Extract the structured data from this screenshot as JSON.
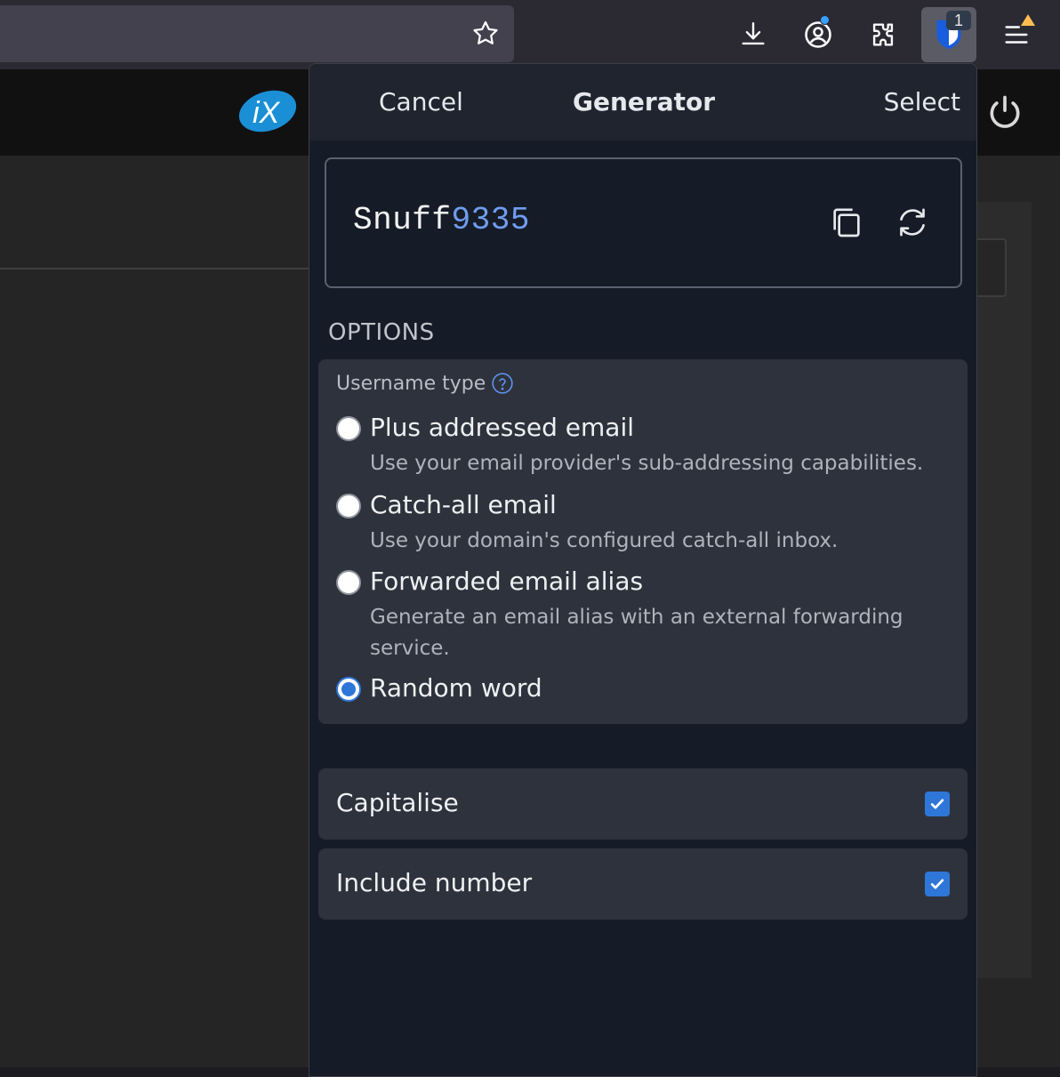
{
  "browser": {
    "extension_badge": "1",
    "icons": [
      "bookmark-star-icon",
      "downloads-icon",
      "account-icon",
      "extensions-icon",
      "bitwarden-icon",
      "menu-icon"
    ]
  },
  "generator": {
    "header": {
      "cancel": "Cancel",
      "title": "Generator",
      "select": "Select"
    },
    "generated": {
      "word": "Snuff",
      "number": "9335"
    },
    "options_heading": "OPTIONS",
    "username_type_label": "Username type",
    "types": [
      {
        "title": "Plus addressed email",
        "description": "Use your email provider's sub-addressing capabilities.",
        "checked": false
      },
      {
        "title": "Catch-all email",
        "description": "Use your domain's configured catch-all inbox.",
        "checked": false
      },
      {
        "title": "Forwarded email alias",
        "description": "Generate an email alias with an external forwarding service.",
        "checked": false
      },
      {
        "title": "Random word",
        "description": "",
        "checked": true
      }
    ],
    "capitalise": {
      "label": "Capitalise",
      "checked": true
    },
    "include_number": {
      "label": "Include number",
      "checked": true
    }
  },
  "colors": {
    "accent": "#2f76d9",
    "number_highlight": "#6f9df1",
    "popup_bg": "#161c27",
    "card_bg": "#2e323c"
  }
}
